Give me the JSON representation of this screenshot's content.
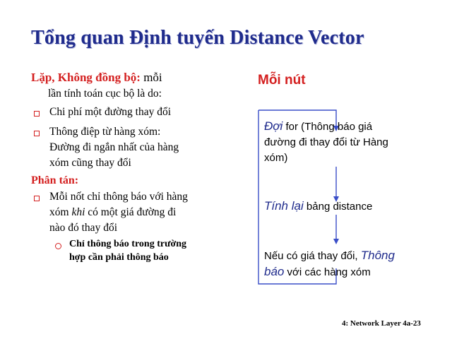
{
  "slide": {
    "title": "Tổng quan Định tuyến Distance Vector",
    "left": {
      "heading1_red": "Lặp, Không đồng bộ:",
      "heading1_rest": " mỗi",
      "heading1_line2": "lần tính toán cục bộ là do:",
      "bullets1": [
        "Chi phí một đường thay đổi",
        "Thông điệp từ hàng xóm:",
        "Đường đi ngắn nhất của hàng",
        "xóm cũng thay đổi"
      ],
      "heading2": "Phân tán:",
      "bullet2_line1": "Mỗi nốt chỉ thông báo với hàng",
      "bullet2_line2_a": "xóm ",
      "bullet2_line2_it": "khi",
      "bullet2_line2_b": " có một giá đường đi",
      "bullet2_line3": "nào đó thay đổi",
      "sub_line1": "Chỉ thông báo trong trường",
      "sub_line2": "hợp cần phải thông báo"
    },
    "right": {
      "title": "Mỗi nút",
      "step1_it": "Đợi",
      "step1_rest": " for (Thông báo giá",
      "step1_line2": "đường đi thay đổi từ Hàng",
      "step1_line3": "xóm)",
      "step2_it": "Tính lại",
      "step2_rest": " bảng distance",
      "step3_a": "Nếu có giá thay đổi, ",
      "step3_it": "Thông",
      "step3_it2": "báo",
      "step3_b": " với các hàng xóm"
    },
    "footer": "4: Network Layer    4a-23",
    "colors": {
      "title": "#1f2b8c",
      "accent_red": "#d42020",
      "flow_line": "#3a4ec8"
    }
  }
}
